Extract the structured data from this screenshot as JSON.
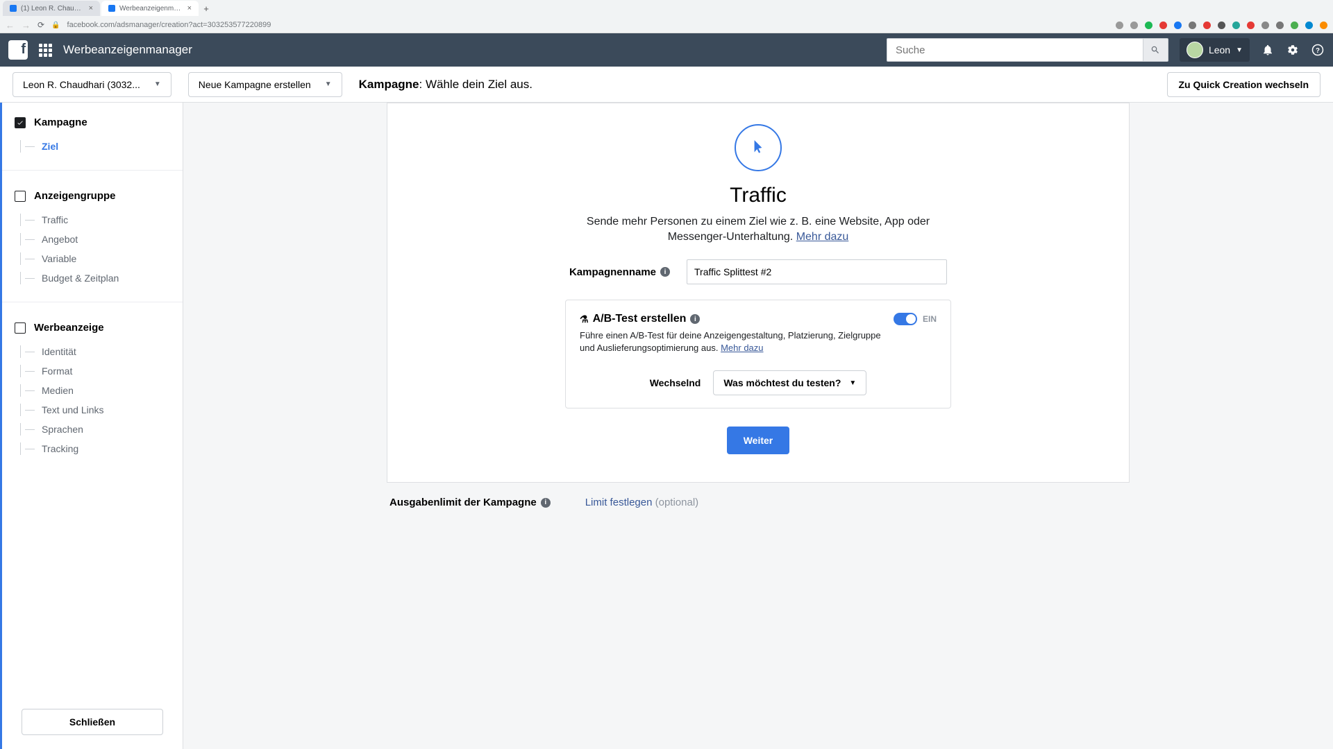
{
  "browser": {
    "tabs": [
      {
        "title": "(1) Leon R. Chaudhari | Faceb"
      },
      {
        "title": "Werbeanzeigenmanager - Cre"
      }
    ],
    "url": "facebook.com/adsmanager/creation?act=303253577220899"
  },
  "header": {
    "app_title": "Werbeanzeigenmanager",
    "search_placeholder": "Suche",
    "user_name": "Leon"
  },
  "subheader": {
    "account": "Leon R. Chaudhari (3032...",
    "campaign_btn": "Neue Kampagne erstellen",
    "breadcrumb_bold": "Kampagne",
    "breadcrumb_rest": ": Wähle dein Ziel aus.",
    "quick": "Zu Quick Creation wechseln"
  },
  "sidebar": {
    "campaign": {
      "title": "Kampagne",
      "items": [
        "Ziel"
      ]
    },
    "adset": {
      "title": "Anzeigengruppe",
      "items": [
        "Traffic",
        "Angebot",
        "Variable",
        "Budget & Zeitplan"
      ]
    },
    "ad": {
      "title": "Werbeanzeige",
      "items": [
        "Identität",
        "Format",
        "Medien",
        "Text und Links",
        "Sprachen",
        "Tracking"
      ]
    },
    "close": "Schließen"
  },
  "main": {
    "title": "Traffic",
    "desc": "Sende mehr Personen zu einem Ziel wie z. B. eine Website, App oder Messenger-Unterhaltung.",
    "more": "Mehr dazu",
    "campaign_name_label": "Kampagnenname",
    "campaign_name_value": "Traffic Splittest #2",
    "ab": {
      "title": "A/B-Test erstellen",
      "desc": "Führe einen A/B-Test für deine Anzeigengestaltung, Platzierung, Zielgruppe und Auslieferungsoptimierung aus.",
      "more": "Mehr dazu",
      "state": "EIN",
      "variable_label": "Wechselnd",
      "variable_select": "Was möchtest du testen?"
    },
    "continue": "Weiter",
    "limit": {
      "title": "Ausgabenlimit der Kampagne",
      "set": "Limit festlegen",
      "optional": "(optional)"
    }
  }
}
